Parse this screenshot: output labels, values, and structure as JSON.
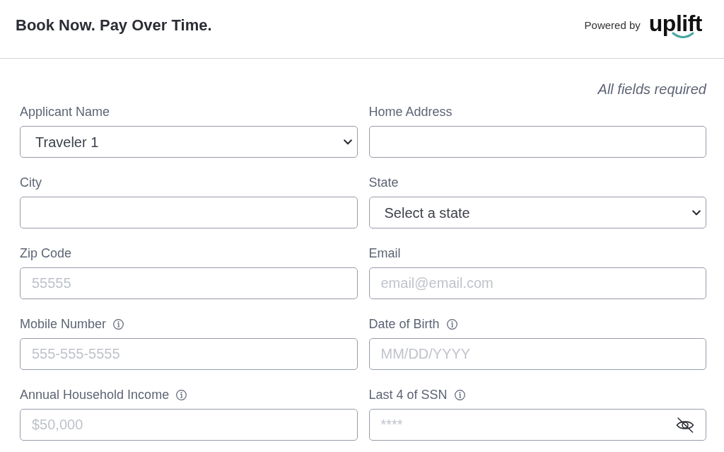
{
  "header": {
    "title": "Book Now. Pay Over Time.",
    "powered_by": "Powered by",
    "logo": "uplift"
  },
  "form": {
    "note": "All fields required",
    "fields": [
      {
        "label": "Applicant Name",
        "kind": "select",
        "value": "Traveler 1",
        "info": false
      },
      {
        "label": "Home Address",
        "kind": "text",
        "info": false
      },
      {
        "label": "City",
        "kind": "text",
        "info": false
      },
      {
        "label": "State",
        "kind": "select",
        "value": "Select a state",
        "info": false
      },
      {
        "label": "Zip Code",
        "kind": "text",
        "placeholder": "55555",
        "info": false
      },
      {
        "label": "Email",
        "kind": "text",
        "placeholder": "email@email.com",
        "info": false
      },
      {
        "label": "Mobile Number",
        "kind": "text",
        "placeholder": "555-555-5555",
        "info": true
      },
      {
        "label": "Date of Birth",
        "kind": "text",
        "placeholder": "MM/DD/YYYY",
        "info": true
      },
      {
        "label": "Annual Household Income",
        "kind": "text",
        "placeholder": "$50,000",
        "info": true
      },
      {
        "label": "Last 4 of SSN",
        "kind": "password",
        "placeholder": "****",
        "info": true
      }
    ]
  }
}
